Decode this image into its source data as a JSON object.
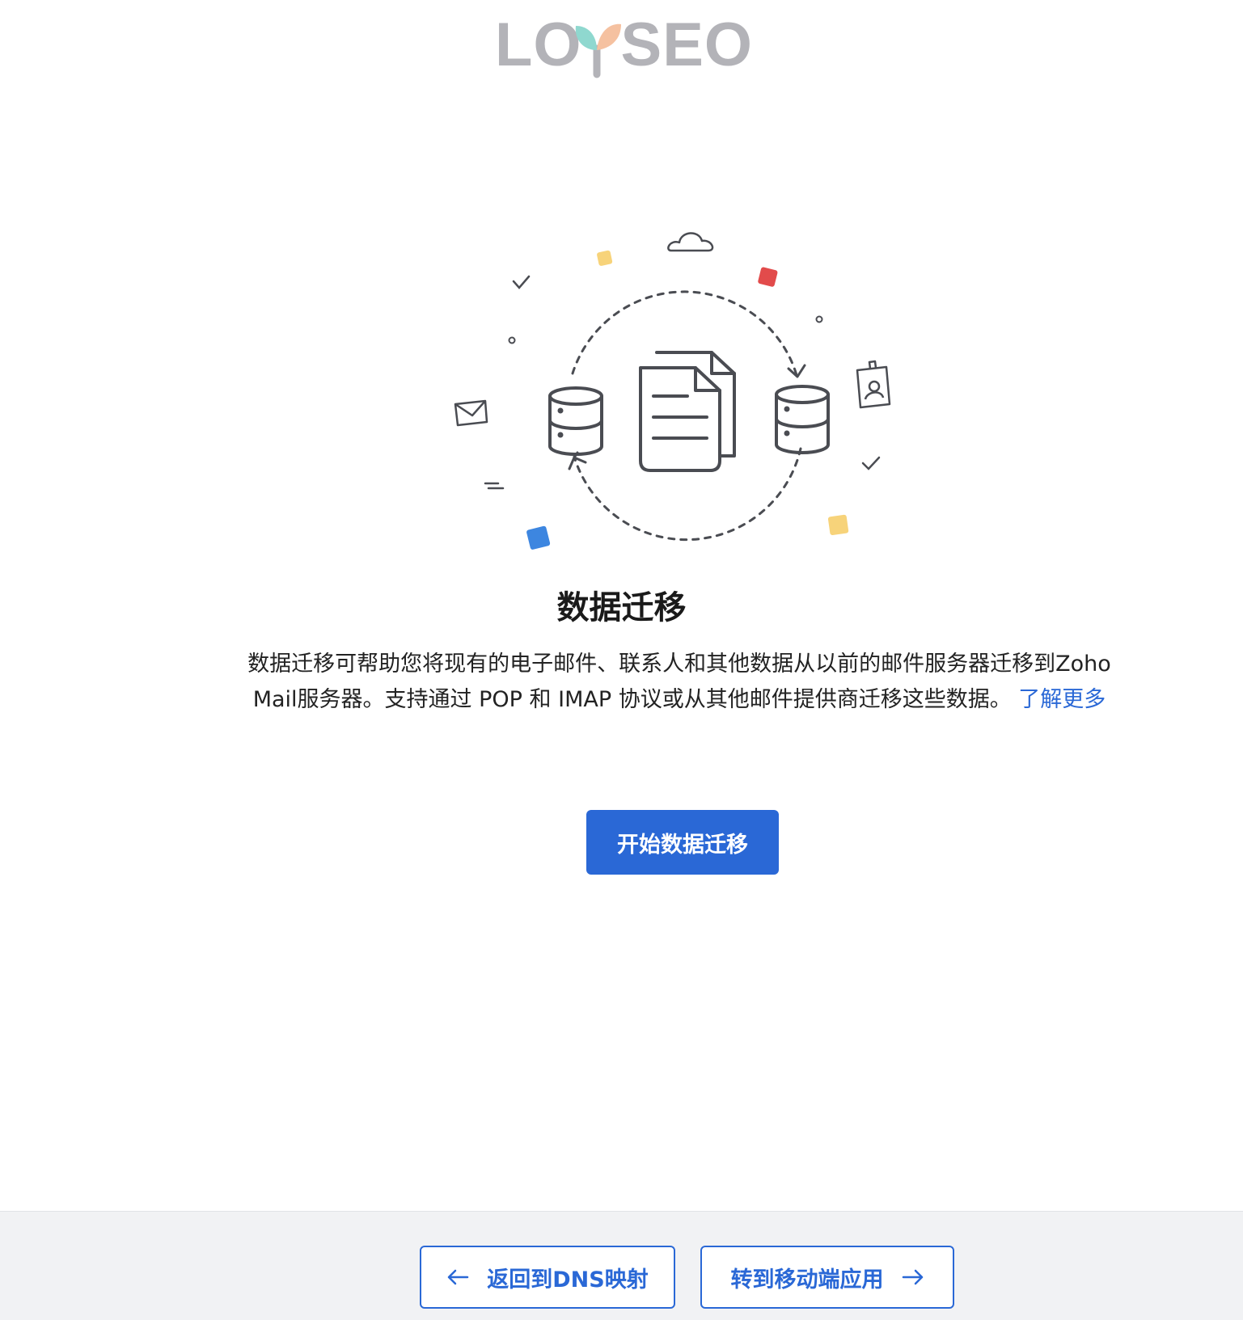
{
  "logo": {
    "text_left": "LO",
    "text_right": "SEO",
    "colors": {
      "text": "#b3b3b8",
      "leaf_teal": "#8fd8cf",
      "leaf_peach": "#f5c1a0"
    }
  },
  "illustration": {
    "icons": [
      "cloud-icon",
      "database-icon",
      "document-icon",
      "envelope-icon",
      "id-badge-icon",
      "checkmark-icon"
    ],
    "accent_colors": [
      "#f7d37a",
      "#e24b4b",
      "#3d86e0"
    ]
  },
  "main": {
    "title": "数据迁移",
    "description": "数据迁移可帮助您将现有的电子邮件、联系人和其他数据从以前的邮件服务器迁移到Zoho Mail服务器。支持通过 POP 和 IMAP 协议或从其他邮件提供商迁移这些数据。",
    "learn_more": "了解更多",
    "start_button": "开始数据迁移"
  },
  "footer": {
    "back_button": "返回到DNS映射",
    "next_button": "转到移动端应用"
  },
  "colors": {
    "primary": "#2a68d6",
    "footer_bg": "#f1f2f4"
  }
}
